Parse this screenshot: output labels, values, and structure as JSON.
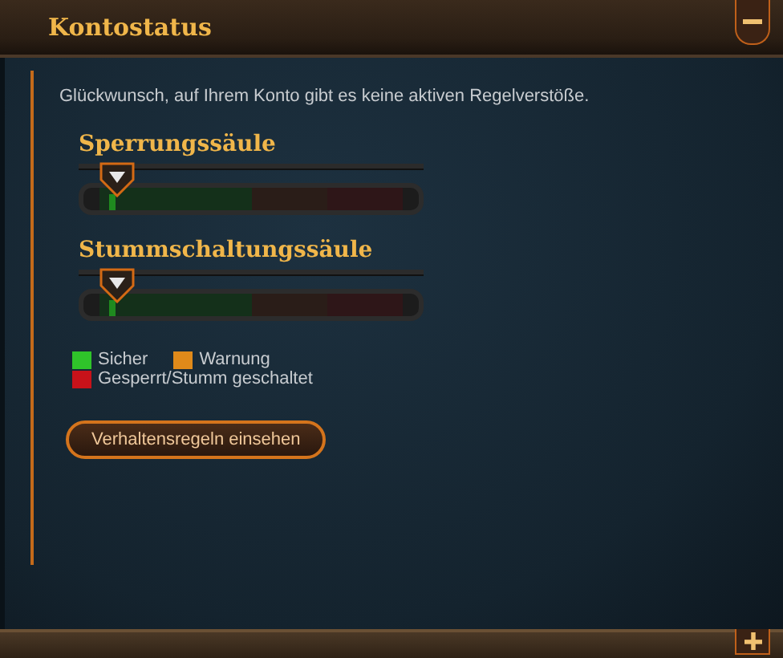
{
  "panel": {
    "title": "Kontostatus",
    "expanded": true
  },
  "message": "Glückwunsch, auf Ihrem Konto gibt es keine aktiven Regelverstöße.",
  "meters": [
    {
      "title": "Sperrungssäule",
      "level": 0
    },
    {
      "title": "Stummschaltungssäule",
      "level": 0
    }
  ],
  "legend": [
    {
      "label": "Sicher",
      "color": "#2fc42a"
    },
    {
      "label": "Warnung",
      "color": "#e08a1a"
    },
    {
      "label": "Gesperrt/Stumm geschaltet",
      "color": "#c8121a"
    }
  ],
  "button": "Verhaltensregeln einsehen",
  "next_panel": {
    "expanded": false
  }
}
